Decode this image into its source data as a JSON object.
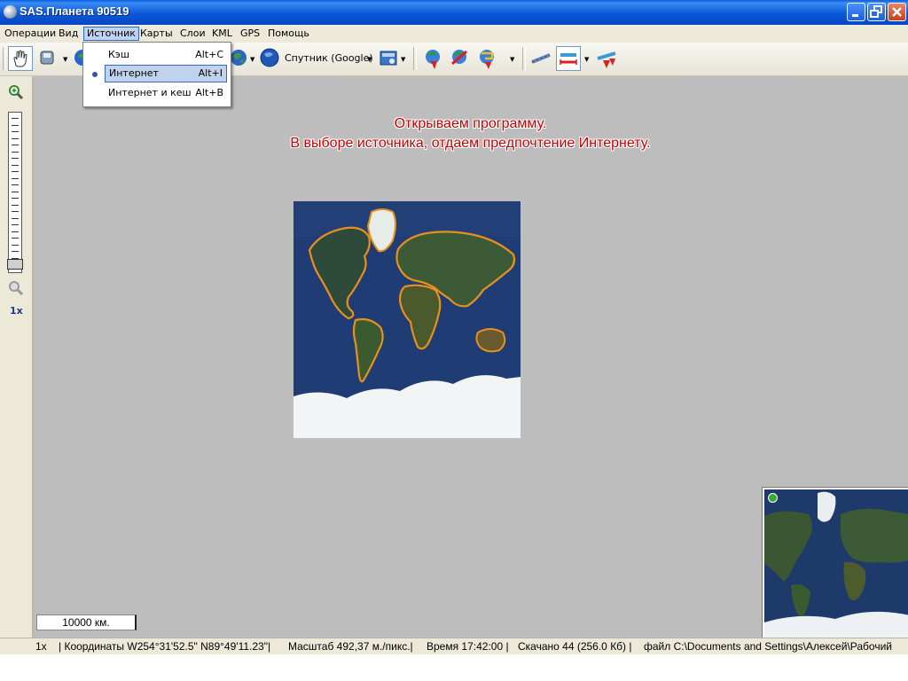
{
  "window": {
    "title": "SAS.Планета 90519",
    "minimize_icon": "minimize-icon",
    "restore_icon": "restore-icon",
    "close_icon": "close-icon"
  },
  "menubar": {
    "items": [
      {
        "label": "Операции"
      },
      {
        "label": "Вид"
      },
      {
        "label": "Источник",
        "active": true
      },
      {
        "label": "Карты"
      },
      {
        "label": "Слои"
      },
      {
        "label": "KML"
      },
      {
        "label": "GPS"
      },
      {
        "label": "Помощь"
      }
    ]
  },
  "source_menu": {
    "items": [
      {
        "label": "Кэш",
        "shortcut": "Alt+C",
        "selected": false
      },
      {
        "label": "Интернет",
        "shortcut": "Alt+I",
        "selected": true
      },
      {
        "label": "Интернет и кеш",
        "shortcut": "Alt+B",
        "selected": false
      }
    ]
  },
  "toolbar": {
    "map_type_label": "Спутник (Google)",
    "icons": [
      "hand-pan-icon",
      "mouse-select-icon",
      "globe-icon",
      "satellite-globe-icon",
      "map-layers-icon",
      "gps-marker-icon",
      "gps-track-icon",
      "gps-route-icon",
      "measure-line-icon",
      "measure-distance-icon",
      "marks-icon"
    ]
  },
  "sidebar": {
    "zoom_in_icon": "zoom-in-icon",
    "zoom_out_icon": "zoom-out-icon",
    "zoom_level_label": "1x",
    "zoom_level": 1
  },
  "map": {
    "caption_line1": "Открываем программу.",
    "caption_line2": "В выборе источника, отдаем предпочтение Интернету.",
    "scale_label": "10000 км."
  },
  "statusbar": {
    "zoom": "1x",
    "coords": "| Координаты W254°31'52.5\" N89°49'11.23\"|",
    "scale": "Масштаб 492,37 м./пикс.|",
    "time": "Время 17:42:00 |",
    "downloaded": "Скачано 44 (256.0 Кб) |",
    "file": "файл C:\\Documents and Settings\\Алексей\\Рабочий"
  },
  "colors": {
    "titlebar": "#0b58d8",
    "chrome": "#ece9d8",
    "map_background": "#bdbdbd",
    "caption_text": "#c40000",
    "selection": "#c1d2ee"
  }
}
